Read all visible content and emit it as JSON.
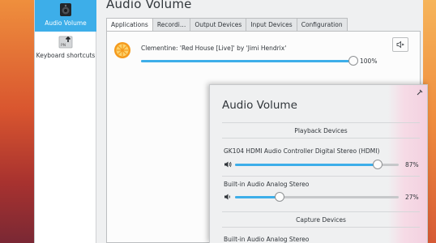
{
  "sidebar": {
    "items": [
      {
        "label": "Audio Volume",
        "icon": "speaker-icon",
        "active": true
      },
      {
        "label": "Keyboard shortcuts",
        "icon": "keyboard-icon",
        "active": false
      }
    ],
    "kbd_icon_text": "PN"
  },
  "main": {
    "title": "Audio Volume",
    "tabs": [
      {
        "label": "Applications",
        "active": true
      },
      {
        "label": "Recordi…",
        "active": false
      },
      {
        "label": "Output Devices",
        "active": false
      },
      {
        "label": "Input Devices",
        "active": false
      },
      {
        "label": "Configuration",
        "active": false
      }
    ],
    "stream": {
      "name": "Clementine: 'Red House [Live]' by 'Jimi Hendrix'",
      "icon": "clementine-orange-icon",
      "volume": 100,
      "volume_label": "100%"
    }
  },
  "popup": {
    "title": "Audio Volume",
    "playback_header": "Playback Devices",
    "capture_header": "Capture Devices",
    "playback_devices": [
      {
        "name": "GK104 HDMI Audio Controller Digital Stereo (HDMI)",
        "volume": 87,
        "volume_label": "87%",
        "icon": "speaker-high-icon"
      },
      {
        "name": "Built-in Audio Analog Stereo",
        "volume": 27,
        "volume_label": "27%",
        "icon": "speaker-low-icon"
      }
    ],
    "capture_devices": [
      {
        "name": "Built-in Audio Analog Stereo"
      }
    ]
  },
  "colors": {
    "accent": "#3daee9",
    "window_bg": "#eff0f1",
    "text": "#31363b"
  }
}
